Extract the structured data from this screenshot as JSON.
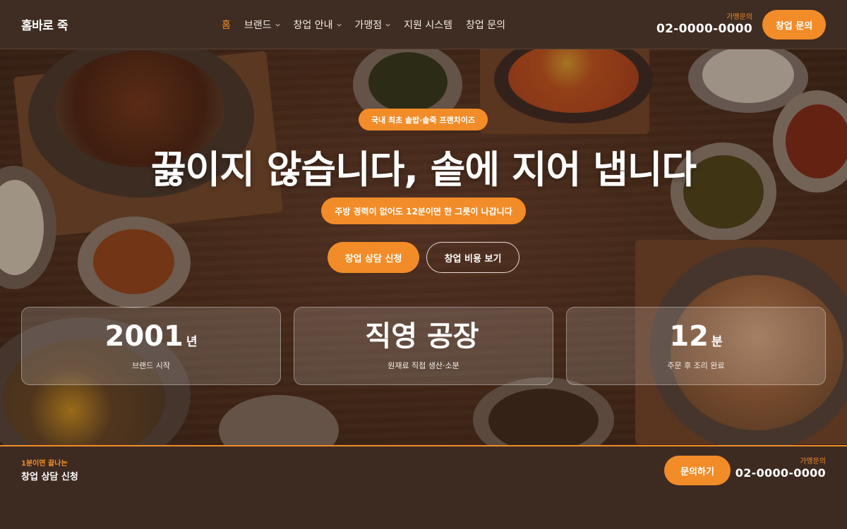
{
  "header": {
    "logo": "홈바로 죽",
    "nav": [
      {
        "label": "홈",
        "active": true,
        "dropdown": false
      },
      {
        "label": "브랜드",
        "active": false,
        "dropdown": true
      },
      {
        "label": "창업 안내",
        "active": false,
        "dropdown": true
      },
      {
        "label": "가맹점",
        "active": false,
        "dropdown": true
      },
      {
        "label": "지원 시스템",
        "active": false,
        "dropdown": false
      },
      {
        "label": "창업 문의",
        "active": false,
        "dropdown": false
      }
    ],
    "phone_label": "가맹문의",
    "phone": "02-0000-0000",
    "cta": "창업 문의"
  },
  "hero": {
    "badge": "국내 최초 솥밥·솥죽 프랜차이즈",
    "headline": "끓이지 않습니다, 솥에 지어 냅니다",
    "subtitle": "주방 경력이 없어도 12분이면 한 그릇이 나갑니다",
    "primary_button": "창업 상담 신청",
    "secondary_button": "창업 비용 보기",
    "stats": [
      {
        "value": "2001",
        "unit": "년",
        "label": "브랜드 시작"
      },
      {
        "value": "직영 공장",
        "unit": "",
        "label": "원재료 직접 생산·소분"
      },
      {
        "value": "12",
        "unit": "분",
        "label": "주문 후 조리 완료"
      }
    ]
  },
  "bottom_bar": {
    "kicker": "1분이면 끝나는",
    "title": "창업 상담 신청",
    "cta": "문의하기",
    "phone_label": "가맹문의",
    "phone": "02-0000-0000"
  },
  "colors": {
    "accent": "#f28c28",
    "background": "#3d2b22",
    "text": "#ffffff"
  },
  "icons": {
    "dropdown": "chevron-down-icon"
  }
}
